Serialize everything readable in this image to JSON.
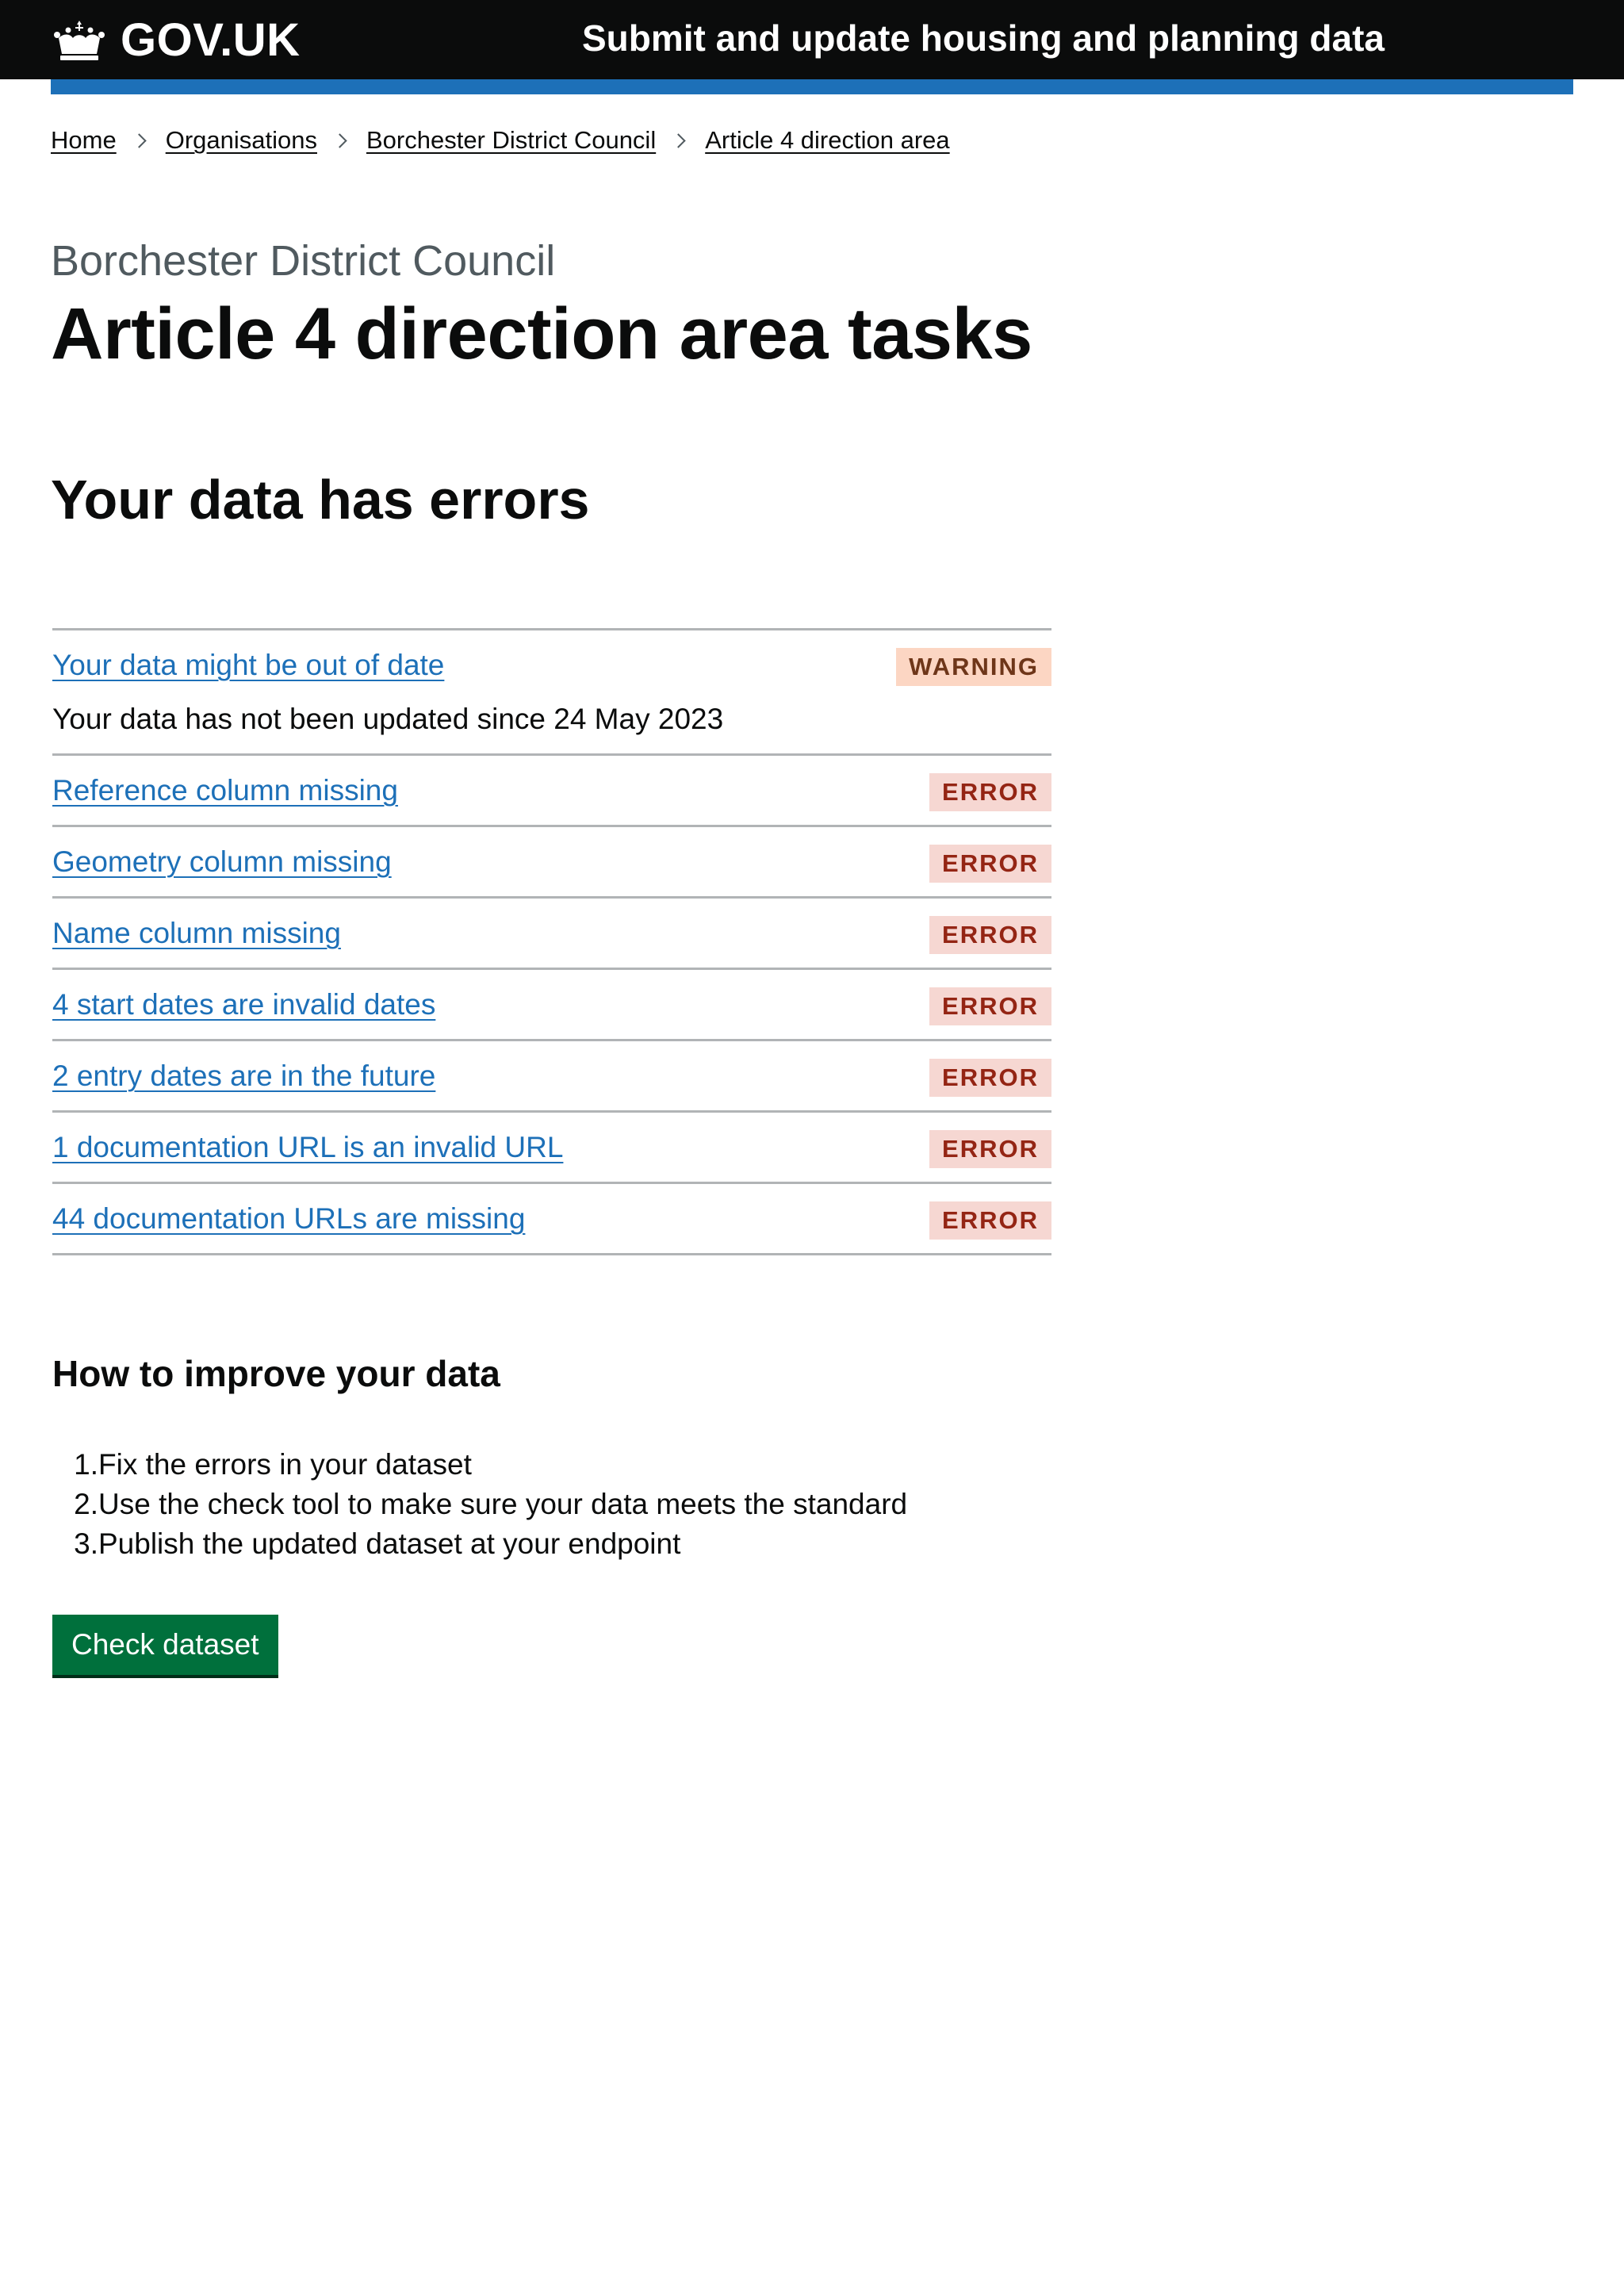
{
  "header": {
    "logo_text": "GOV.UK",
    "service_name": "Submit and update housing and planning data"
  },
  "breadcrumbs": [
    {
      "label": "Home"
    },
    {
      "label": "Organisations"
    },
    {
      "label": "Borchester District Council"
    },
    {
      "label": "Article 4 direction area"
    }
  ],
  "page": {
    "caption": "Borchester District Council",
    "title": "Article 4 direction area tasks",
    "section_heading": "Your data has errors"
  },
  "tasks": [
    {
      "label": "Your data might be out of date",
      "status": "WARNING",
      "hint": "Your data has not been updated since 24 May 2023"
    },
    {
      "label": "Reference column missing",
      "status": "ERROR"
    },
    {
      "label": "Geometry column missing",
      "status": "ERROR"
    },
    {
      "label": "Name column missing",
      "status": "ERROR"
    },
    {
      "label": "4 start dates are invalid dates",
      "status": "ERROR"
    },
    {
      "label": "2 entry dates are in the future",
      "status": "ERROR"
    },
    {
      "label": "1 documentation URL is an invalid URL",
      "status": "ERROR"
    },
    {
      "label": "44 documentation URLs are missing",
      "status": "ERROR"
    }
  ],
  "improve": {
    "heading": "How to improve your data",
    "steps": [
      {
        "num": "1.",
        "text": "Fix the errors in your dataset"
      },
      {
        "num": "2.",
        "text": "Use the check tool to make sure your data meets the standard"
      },
      {
        "num": "3.",
        "text": "Publish the updated dataset at your endpoint"
      }
    ],
    "button_label": "Check dataset"
  },
  "colors": {
    "header_bg": "#0b0c0c",
    "brand_blue": "#1d70b8",
    "link": "#1d70b8",
    "error_tag_bg": "#f6d7d2",
    "error_tag_text": "#942514",
    "warning_tag_bg": "#fcd6c3",
    "warning_tag_text": "#6e3619",
    "button_green": "#00703c"
  },
  "icons": {
    "logo": "crown-icon",
    "breadcrumb_separator": "chevron-right-icon"
  }
}
